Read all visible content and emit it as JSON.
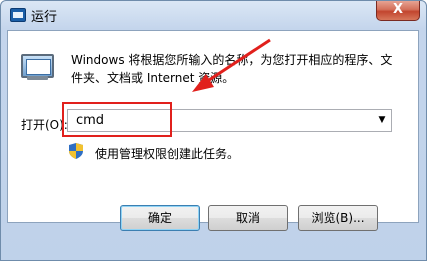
{
  "window": {
    "title": "运行",
    "close_glyph": "X"
  },
  "content": {
    "description": "Windows 将根据您所输入的名称，为您打开相应的程序、文件夹、文档或 Internet 资源。",
    "open_label": "打开(O):",
    "command_value": "cmd",
    "admin_note": "使用管理权限创建此任务。"
  },
  "buttons": {
    "ok": "确定",
    "cancel": "取消",
    "browse": "浏览(B)..."
  },
  "annotation": {
    "highlight_color": "#e1201c",
    "arrow_color": "#e1201c"
  }
}
